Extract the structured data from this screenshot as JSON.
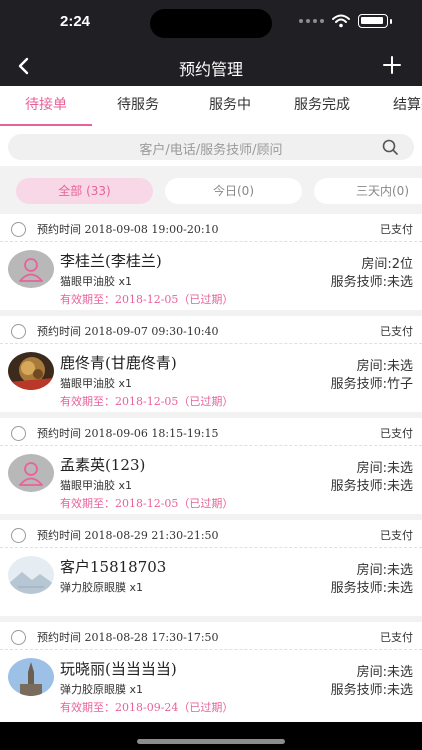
{
  "status_bar": {
    "time": "2:24"
  },
  "header": {
    "title": "预约管理"
  },
  "tabs": [
    {
      "label": "待接单",
      "active": true
    },
    {
      "label": "待服务",
      "active": false
    },
    {
      "label": "服务中",
      "active": false
    },
    {
      "label": "服务完成",
      "active": false
    },
    {
      "label": "结算完",
      "active": false
    }
  ],
  "search": {
    "placeholder": "客户/电话/服务技师/顾问"
  },
  "filters": [
    {
      "label": "全部 (33)",
      "active": true
    },
    {
      "label": "今日(0)",
      "active": false
    },
    {
      "label": "三天内(0)",
      "active": false
    }
  ],
  "appointments": [
    {
      "time": "预约时间 2018-09-08 19:00-20:10",
      "payment": "已支付",
      "customer": "李桂兰(李桂兰)",
      "service": "猫眼甲油胶 x1",
      "expiry": "有效期至：2018-12-05（已过期）",
      "room": "房间:2位",
      "tech": "服务技师:未选",
      "avatar": "default-avatar"
    },
    {
      "time": "预约时间 2018-09-07 09:30-10:40",
      "payment": "已支付",
      "customer": "鹿佟青(甘鹿佟青)",
      "service": "猫眼甲油胶 x1",
      "expiry": "有效期至：2018-12-05（已过期）",
      "room": "房间:未选",
      "tech": "服务技师:竹子",
      "avatar": "photo-flower"
    },
    {
      "time": "预约时间 2018-09-06 18:15-19:15",
      "payment": "已支付",
      "customer": "孟素英(123)",
      "service": "猫眼甲油胶 x1",
      "expiry": "有效期至：2018-12-05（已过期）",
      "room": "房间:未选",
      "tech": "服务技师:未选",
      "avatar": "default-avatar"
    },
    {
      "time": "预约时间 2018-08-29 21:30-21:50",
      "payment": "已支付",
      "customer": "客户15818703",
      "service": "弹力胶原眼膜 x1",
      "expiry": "",
      "room": "房间:未选",
      "tech": "服务技师:未选",
      "avatar": "photo-landscape"
    },
    {
      "time": "预约时间 2018-08-28 17:30-17:50",
      "payment": "已支付",
      "customer": "玩晓丽(当当当当)",
      "service": "弹力胶原眼膜 x1",
      "expiry": "有效期至：2018-09-24（已过期）",
      "room": "房间:未选",
      "tech": "服务技师:未选",
      "avatar": "photo-tower"
    }
  ],
  "colors": {
    "accent": "#e8629a",
    "header_bg": "#1f1f24"
  }
}
